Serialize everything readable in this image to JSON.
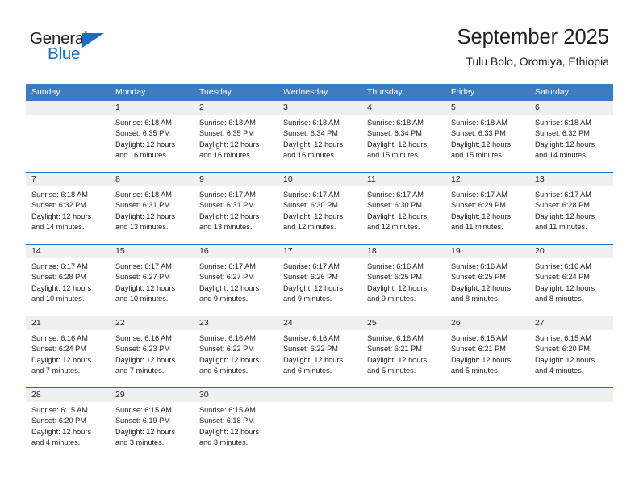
{
  "logo": {
    "word_top": "General",
    "word_bottom": "Blue",
    "accent_color": "#1c6fba"
  },
  "header": {
    "title": "September 2025",
    "subtitle": "Tulu Bolo, Oromiya, Ethiopia"
  },
  "calendar": {
    "header_bg": "#3d7dbf",
    "day_number_bg": "#efefef",
    "divider_color": "#1c6fba",
    "weekdays": [
      "Sunday",
      "Monday",
      "Tuesday",
      "Wednesday",
      "Thursday",
      "Friday",
      "Saturday"
    ],
    "weeks": [
      [
        {
          "day": "",
          "sunrise": "",
          "sunset": "",
          "daylight_line1": "",
          "daylight_line2": ""
        },
        {
          "day": "1",
          "sunrise": "Sunrise: 6:18 AM",
          "sunset": "Sunset: 6:35 PM",
          "daylight_line1": "Daylight: 12 hours",
          "daylight_line2": "and 16 minutes."
        },
        {
          "day": "2",
          "sunrise": "Sunrise: 6:18 AM",
          "sunset": "Sunset: 6:35 PM",
          "daylight_line1": "Daylight: 12 hours",
          "daylight_line2": "and 16 minutes."
        },
        {
          "day": "3",
          "sunrise": "Sunrise: 6:18 AM",
          "sunset": "Sunset: 6:34 PM",
          "daylight_line1": "Daylight: 12 hours",
          "daylight_line2": "and 16 minutes."
        },
        {
          "day": "4",
          "sunrise": "Sunrise: 6:18 AM",
          "sunset": "Sunset: 6:34 PM",
          "daylight_line1": "Daylight: 12 hours",
          "daylight_line2": "and 15 minutes."
        },
        {
          "day": "5",
          "sunrise": "Sunrise: 6:18 AM",
          "sunset": "Sunset: 6:33 PM",
          "daylight_line1": "Daylight: 12 hours",
          "daylight_line2": "and 15 minutes."
        },
        {
          "day": "6",
          "sunrise": "Sunrise: 6:18 AM",
          "sunset": "Sunset: 6:32 PM",
          "daylight_line1": "Daylight: 12 hours",
          "daylight_line2": "and 14 minutes."
        }
      ],
      [
        {
          "day": "7",
          "sunrise": "Sunrise: 6:18 AM",
          "sunset": "Sunset: 6:32 PM",
          "daylight_line1": "Daylight: 12 hours",
          "daylight_line2": "and 14 minutes."
        },
        {
          "day": "8",
          "sunrise": "Sunrise: 6:18 AM",
          "sunset": "Sunset: 6:31 PM",
          "daylight_line1": "Daylight: 12 hours",
          "daylight_line2": "and 13 minutes."
        },
        {
          "day": "9",
          "sunrise": "Sunrise: 6:17 AM",
          "sunset": "Sunset: 6:31 PM",
          "daylight_line1": "Daylight: 12 hours",
          "daylight_line2": "and 13 minutes."
        },
        {
          "day": "10",
          "sunrise": "Sunrise: 6:17 AM",
          "sunset": "Sunset: 6:30 PM",
          "daylight_line1": "Daylight: 12 hours",
          "daylight_line2": "and 12 minutes."
        },
        {
          "day": "11",
          "sunrise": "Sunrise: 6:17 AM",
          "sunset": "Sunset: 6:30 PM",
          "daylight_line1": "Daylight: 12 hours",
          "daylight_line2": "and 12 minutes."
        },
        {
          "day": "12",
          "sunrise": "Sunrise: 6:17 AM",
          "sunset": "Sunset: 6:29 PM",
          "daylight_line1": "Daylight: 12 hours",
          "daylight_line2": "and 11 minutes."
        },
        {
          "day": "13",
          "sunrise": "Sunrise: 6:17 AM",
          "sunset": "Sunset: 6:28 PM",
          "daylight_line1": "Daylight: 12 hours",
          "daylight_line2": "and 11 minutes."
        }
      ],
      [
        {
          "day": "14",
          "sunrise": "Sunrise: 6:17 AM",
          "sunset": "Sunset: 6:28 PM",
          "daylight_line1": "Daylight: 12 hours",
          "daylight_line2": "and 10 minutes."
        },
        {
          "day": "15",
          "sunrise": "Sunrise: 6:17 AM",
          "sunset": "Sunset: 6:27 PM",
          "daylight_line1": "Daylight: 12 hours",
          "daylight_line2": "and 10 minutes."
        },
        {
          "day": "16",
          "sunrise": "Sunrise: 6:17 AM",
          "sunset": "Sunset: 6:27 PM",
          "daylight_line1": "Daylight: 12 hours",
          "daylight_line2": "and 9 minutes."
        },
        {
          "day": "17",
          "sunrise": "Sunrise: 6:17 AM",
          "sunset": "Sunset: 6:26 PM",
          "daylight_line1": "Daylight: 12 hours",
          "daylight_line2": "and 9 minutes."
        },
        {
          "day": "18",
          "sunrise": "Sunrise: 6:16 AM",
          "sunset": "Sunset: 6:25 PM",
          "daylight_line1": "Daylight: 12 hours",
          "daylight_line2": "and 9 minutes."
        },
        {
          "day": "19",
          "sunrise": "Sunrise: 6:16 AM",
          "sunset": "Sunset: 6:25 PM",
          "daylight_line1": "Daylight: 12 hours",
          "daylight_line2": "and 8 minutes."
        },
        {
          "day": "20",
          "sunrise": "Sunrise: 6:16 AM",
          "sunset": "Sunset: 6:24 PM",
          "daylight_line1": "Daylight: 12 hours",
          "daylight_line2": "and 8 minutes."
        }
      ],
      [
        {
          "day": "21",
          "sunrise": "Sunrise: 6:16 AM",
          "sunset": "Sunset: 6:24 PM",
          "daylight_line1": "Daylight: 12 hours",
          "daylight_line2": "and 7 minutes."
        },
        {
          "day": "22",
          "sunrise": "Sunrise: 6:16 AM",
          "sunset": "Sunset: 6:23 PM",
          "daylight_line1": "Daylight: 12 hours",
          "daylight_line2": "and 7 minutes."
        },
        {
          "day": "23",
          "sunrise": "Sunrise: 6:16 AM",
          "sunset": "Sunset: 6:22 PM",
          "daylight_line1": "Daylight: 12 hours",
          "daylight_line2": "and 6 minutes."
        },
        {
          "day": "24",
          "sunrise": "Sunrise: 6:16 AM",
          "sunset": "Sunset: 6:22 PM",
          "daylight_line1": "Daylight: 12 hours",
          "daylight_line2": "and 6 minutes."
        },
        {
          "day": "25",
          "sunrise": "Sunrise: 6:16 AM",
          "sunset": "Sunset: 6:21 PM",
          "daylight_line1": "Daylight: 12 hours",
          "daylight_line2": "and 5 minutes."
        },
        {
          "day": "26",
          "sunrise": "Sunrise: 6:15 AM",
          "sunset": "Sunset: 6:21 PM",
          "daylight_line1": "Daylight: 12 hours",
          "daylight_line2": "and 5 minutes."
        },
        {
          "day": "27",
          "sunrise": "Sunrise: 6:15 AM",
          "sunset": "Sunset: 6:20 PM",
          "daylight_line1": "Daylight: 12 hours",
          "daylight_line2": "and 4 minutes."
        }
      ],
      [
        {
          "day": "28",
          "sunrise": "Sunrise: 6:15 AM",
          "sunset": "Sunset: 6:20 PM",
          "daylight_line1": "Daylight: 12 hours",
          "daylight_line2": "and 4 minutes."
        },
        {
          "day": "29",
          "sunrise": "Sunrise: 6:15 AM",
          "sunset": "Sunset: 6:19 PM",
          "daylight_line1": "Daylight: 12 hours",
          "daylight_line2": "and 3 minutes."
        },
        {
          "day": "30",
          "sunrise": "Sunrise: 6:15 AM",
          "sunset": "Sunset: 6:18 PM",
          "daylight_line1": "Daylight: 12 hours",
          "daylight_line2": "and 3 minutes."
        },
        {
          "day": "",
          "sunrise": "",
          "sunset": "",
          "daylight_line1": "",
          "daylight_line2": ""
        },
        {
          "day": "",
          "sunrise": "",
          "sunset": "",
          "daylight_line1": "",
          "daylight_line2": ""
        },
        {
          "day": "",
          "sunrise": "",
          "sunset": "",
          "daylight_line1": "",
          "daylight_line2": ""
        },
        {
          "day": "",
          "sunrise": "",
          "sunset": "",
          "daylight_line1": "",
          "daylight_line2": ""
        }
      ]
    ]
  }
}
